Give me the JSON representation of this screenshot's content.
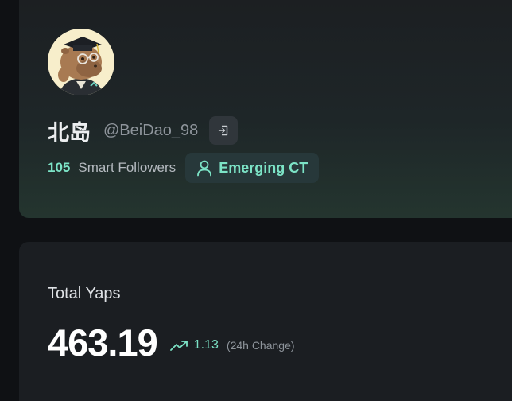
{
  "profile": {
    "display_name": "北岛",
    "handle": "@BeiDao_98",
    "avatar_icon": "capybara-graduate-avatar",
    "login_icon": "sign-in-icon",
    "smart_followers": {
      "count": "105",
      "label": "Smart Followers"
    },
    "badge": {
      "icon": "user-icon",
      "label": "Emerging CT"
    }
  },
  "yaps": {
    "title": "Total Yaps",
    "value": "463.19",
    "change_icon": "trending-up-icon",
    "change_value": "1.13",
    "change_label": "(24h Change)"
  },
  "colors": {
    "accent": "#7ce3c6",
    "background": "#0f1114",
    "card": "#1b1e22"
  }
}
